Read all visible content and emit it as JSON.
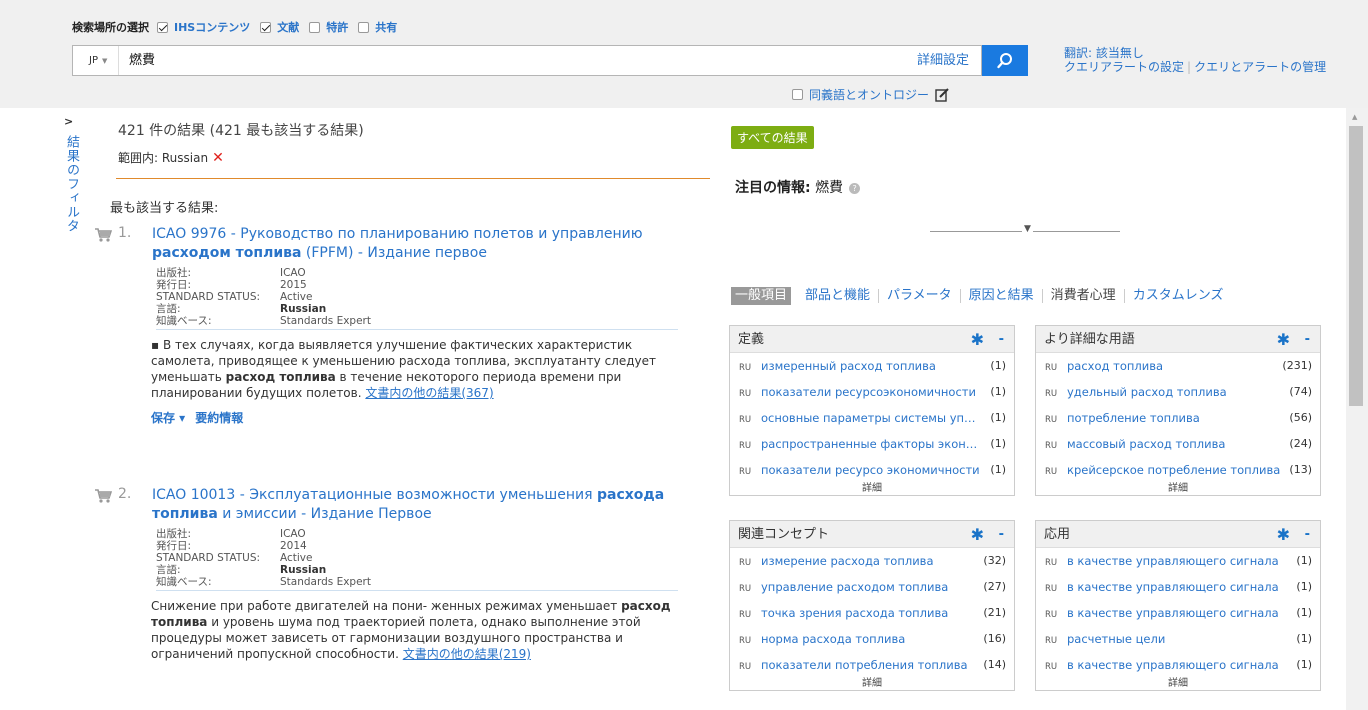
{
  "search": {
    "scope_label": "検索場所の選択",
    "scope_options": [
      {
        "label": "IHSコンテンツ",
        "checked": true
      },
      {
        "label": "文献",
        "checked": true
      },
      {
        "label": "特許",
        "checked": false
      },
      {
        "label": "共有",
        "checked": false
      }
    ],
    "language": "JP",
    "query": "燃費",
    "advanced_label": "詳細設定",
    "synonym_label": "同義語とオントロジー",
    "synonym_checked": false,
    "translation_label": "翻訳: 該当無し",
    "query_alert_label": "クエリアラートの設定",
    "manage_label": "クエリとアラートの管理"
  },
  "filter": {
    "label": "結果のフィルタ"
  },
  "results": {
    "count_label": "421 件の結果 (421 最も該当する結果)",
    "scope_prefix": "範囲内:",
    "scope_value": "Russian",
    "best_header": "最も該当する結果:",
    "items": [
      {
        "num": "1.",
        "title_pre": "ICAO 9976 - Руководство по планированию полетов и управлению ",
        "title_bold": "расходом топлива",
        "title_post": " (FPFM) - Издание первое",
        "meta": [
          {
            "k": "出版社:",
            "v": "ICAO"
          },
          {
            "k": "発行日:",
            "v": "2015"
          },
          {
            "k": "STANDARD STATUS:",
            "v": "Active"
          },
          {
            "k": "言語:",
            "v": "Russian"
          },
          {
            "k": "知識ベース:",
            "v": "Standards Expert"
          }
        ],
        "snippet_1": "▪ В тех случаях, когда выявляется улучшение фактических характеристик самолета, приводящее к уменьшению расхода топлива, эксплуатанту следует уменьшать ",
        "snippet_bold": "расход топлива",
        "snippet_2": " в течение некоторого периода времени при планировании будущих полетов. ",
        "more": "文書内の他の結果(367)",
        "save_label": "保存 ▾",
        "summary_label": "要約情報"
      },
      {
        "num": "2.",
        "title_pre": "ICAO 10013 - Эксплуатационные возможности уменьшения ",
        "title_bold": "расхода топлива",
        "title_post": " и эмиссии - Издание Первое",
        "meta": [
          {
            "k": "出版社:",
            "v": "ICAO"
          },
          {
            "k": "発行日:",
            "v": "2014"
          },
          {
            "k": "STANDARD STATUS:",
            "v": "Active"
          },
          {
            "k": "言語:",
            "v": "Russian"
          },
          {
            "k": "知識ベース:",
            "v": "Standards Expert"
          }
        ],
        "snippet_1": "Снижение при работе двигателей на пони- женных режимах уменьшает ",
        "snippet_bold": "расход топлива",
        "snippet_2": " и уровень шума под траекторией полета, однако выполнение этой процедуры может зависеть от гармонизации воздушного пространства и ограничений пропускной способности. ",
        "more": "文書内の他の結果(219)"
      }
    ]
  },
  "panel": {
    "all_results": "すべての結果",
    "featured_label": "注目の情報:",
    "featured_term": "燃費",
    "lens_tabs": [
      "一般項目",
      "部品と機能",
      "パラメータ",
      "原因と結果",
      "消費者心理",
      "カスタムレンズ"
    ],
    "lang_code": "RU",
    "more_label": "詳細",
    "boxes": [
      {
        "title": "定義",
        "rows": [
          {
            "term": "измеренный расход топлива",
            "count": "(1)"
          },
          {
            "term": "показатели ресурсоэкономичности",
            "count": "(1)"
          },
          {
            "term": "основные параметры системы управления",
            "count": "(1)"
          },
          {
            "term": "распространенные факторы экономии",
            "count": "(1)"
          },
          {
            "term": "показатели ресурсо экономичности",
            "count": "(1)"
          }
        ]
      },
      {
        "title": "より詳細な用語",
        "rows": [
          {
            "term": "расход топлива",
            "count": "(231)"
          },
          {
            "term": "удельный расход топлива",
            "count": "(74)"
          },
          {
            "term": "потребление топлива",
            "count": "(56)"
          },
          {
            "term": "массовый расход топлива",
            "count": "(24)"
          },
          {
            "term": "крейсерское потребление топлива",
            "count": "(13)"
          }
        ]
      },
      {
        "title": "関連コンセプト",
        "rows": [
          {
            "term": "измерение расхода топлива",
            "count": "(32)"
          },
          {
            "term": "управление расходом топлива",
            "count": "(27)"
          },
          {
            "term": "точка зрения расхода топлива",
            "count": "(21)"
          },
          {
            "term": "норма расхода топлива",
            "count": "(16)"
          },
          {
            "term": "показатели потребления топлива",
            "count": "(14)"
          }
        ]
      },
      {
        "title": "応用",
        "rows": [
          {
            "term": "в качестве управляющего сигнала",
            "count": "(1)"
          },
          {
            "term": "в качестве управляющего сигнала",
            "count": "(1)"
          },
          {
            "term": "в качестве управляющего сигнала",
            "count": "(1)"
          },
          {
            "term": "расчетные цели",
            "count": "(1)"
          },
          {
            "term": "в качестве управляющего сигнала",
            "count": "(1)"
          }
        ]
      }
    ]
  },
  "colors": {
    "accent": "#1a7ae0",
    "link": "#2a74c9",
    "badge": "#7dad12",
    "remove": "#e0201b",
    "divider": "#e08a2c"
  }
}
